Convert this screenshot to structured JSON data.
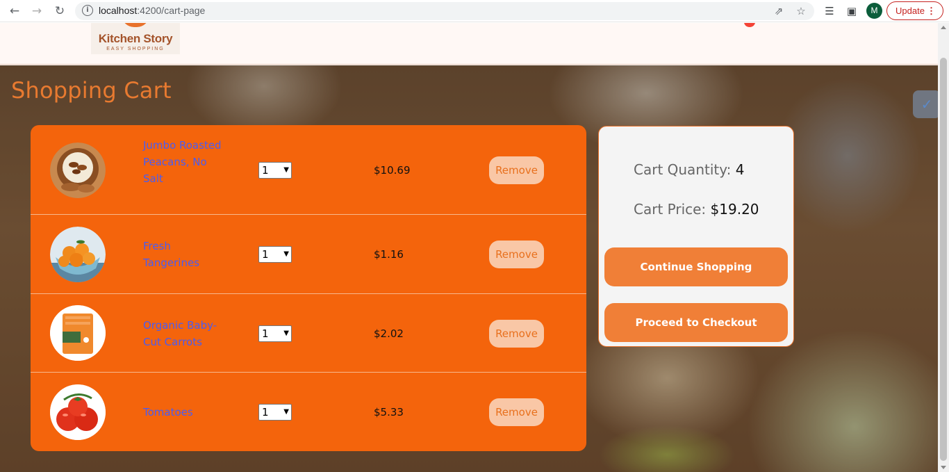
{
  "browser": {
    "url_host": "localhost",
    "url_path": ":4200/cart-page",
    "update_label": "Update",
    "avatar_initial": "M"
  },
  "header": {
    "logo_name": "Kitchen Story",
    "logo_tagline": "EASY SHOPPING"
  },
  "page": {
    "title": "Shopping Cart"
  },
  "cart": {
    "items": [
      {
        "name": "Jumbo Roasted Peacans, No Salt",
        "quantity": "1",
        "price": "$10.69",
        "remove_label": "Remove"
      },
      {
        "name": "Fresh Tangerines",
        "quantity": "1",
        "price": "$1.16",
        "remove_label": "Remove"
      },
      {
        "name": "Organic Baby-Cut Carrots",
        "quantity": "1",
        "price": "$2.02",
        "remove_label": "Remove"
      },
      {
        "name": "Tomatoes",
        "quantity": "1",
        "price": "$5.33",
        "remove_label": "Remove"
      }
    ]
  },
  "summary": {
    "quantity_label": "Cart Quantity:",
    "quantity_value": "4",
    "price_label": "Cart Price:",
    "price_value": "$19.20",
    "continue_label": "Continue Shopping",
    "checkout_label": "Proceed to Checkout"
  },
  "colors": {
    "accent": "#f4640c",
    "button": "#f07f37",
    "title": "#e87a30",
    "link": "#4a5cf2"
  },
  "icons": [
    "back-arrow-icon",
    "forward-arrow-icon",
    "reload-icon",
    "info-icon",
    "share-icon",
    "star-icon",
    "reading-list-icon",
    "side-panel-icon",
    "more-vert-icon",
    "extension-widget-icon"
  ]
}
